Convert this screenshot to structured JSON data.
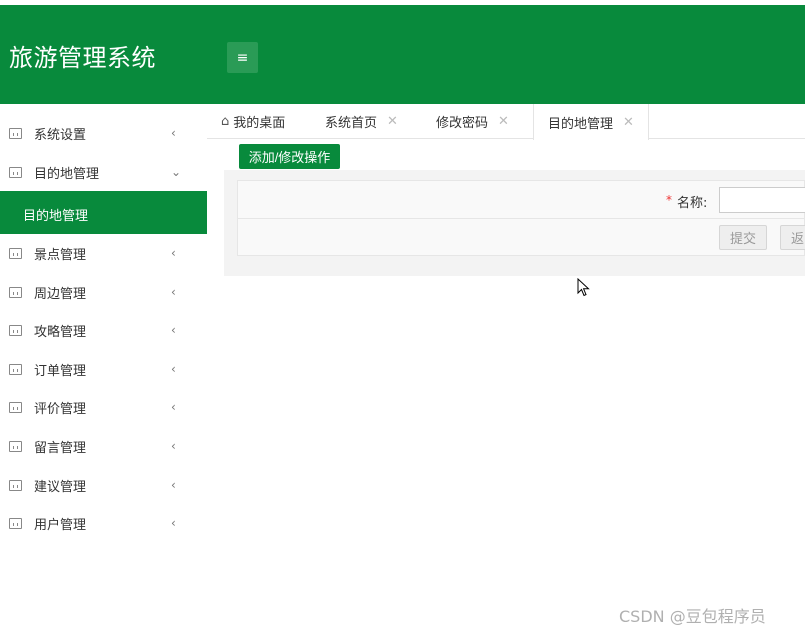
{
  "header": {
    "title": "旅游管理系统",
    "menu_icon": "hamburger-icon",
    "background": "#088a3c"
  },
  "sidebar": {
    "items": [
      {
        "label": "系统设置",
        "arrow": "‹"
      },
      {
        "label": "目的地管理",
        "arrow": "⌄"
      },
      {
        "label": "景点管理",
        "arrow": "‹"
      },
      {
        "label": "周边管理",
        "arrow": "‹"
      },
      {
        "label": "攻略管理",
        "arrow": "‹"
      },
      {
        "label": "订单管理",
        "arrow": "‹"
      },
      {
        "label": "评价管理",
        "arrow": "‹"
      },
      {
        "label": "留言管理",
        "arrow": "‹"
      },
      {
        "label": "建议管理",
        "arrow": "‹"
      },
      {
        "label": "用户管理",
        "arrow": "‹"
      }
    ],
    "active_sub": "目的地管理"
  },
  "tabs": [
    {
      "label": "我的桌面",
      "close": ""
    },
    {
      "label": "系统首页",
      "close": "✕"
    },
    {
      "label": "修改密码",
      "close": "✕"
    },
    {
      "label": "目的地管理",
      "close": "✕"
    }
  ],
  "toolbar": {
    "op_label": "添加/修改操作"
  },
  "form": {
    "required_mark": "*",
    "name_label": "名称:",
    "name_value": "",
    "submit_label": "提交",
    "back_label": "返回"
  },
  "watermark": "CSDN @豆包程序员"
}
